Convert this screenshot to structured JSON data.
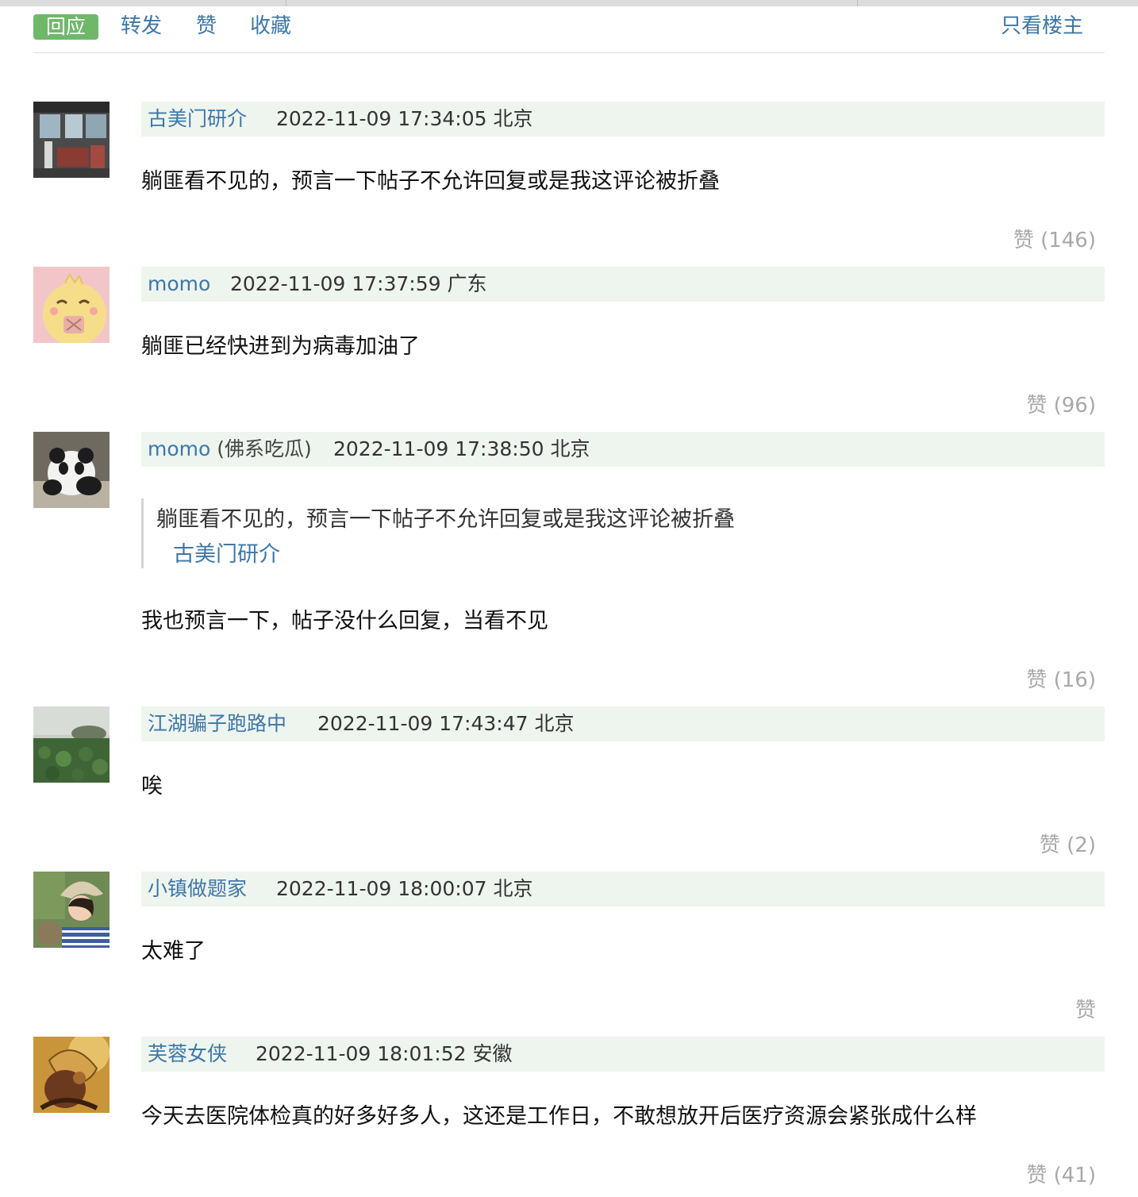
{
  "toolbar": {
    "reply": "回应",
    "forward": "转发",
    "like": "赞",
    "collect": "收藏",
    "op_only": "只看楼主"
  },
  "comments": [
    {
      "author": "古美门研介",
      "time": "2022-11-09 17:34:05 北京",
      "content": "躺匪看不见的，预言一下帖子不允许回复或是我这评论被折叠",
      "likes": "赞 (146)",
      "avatar_icon": "bus-interior-photo-icon"
    },
    {
      "author": "momo",
      "time": "2022-11-09 17:37:59 广东",
      "content": "躺匪已经快进到为病毒加油了",
      "likes": "赞 (96)",
      "avatar_icon": "cartoon-chick-icon"
    },
    {
      "author": "momo",
      "nick": "(佛系吃瓜)",
      "time": "2022-11-09 17:38:50 北京",
      "quote_text": "躺匪看不见的，预言一下帖子不允许回复或是我这评论被折叠",
      "quote_author": "古美门研介",
      "content": "我也预言一下，帖子没什么回复，当看不见",
      "likes": "赞 (16)",
      "avatar_icon": "panda-photo-icon"
    },
    {
      "author": "江湖骗子跑路中",
      "time": "2022-11-09 17:43:47 北京",
      "content": "唉",
      "likes": "赞 (2)",
      "avatar_icon": "lotus-pond-photo-icon"
    },
    {
      "author": "小镇做题家",
      "time": "2022-11-09 18:00:07 北京",
      "content": "太难了",
      "likes": "赞",
      "avatar_icon": "girl-sunhat-photo-icon"
    },
    {
      "author": "芙蓉女侠",
      "time": "2022-11-09 18:01:52 安徽",
      "content": "今天去医院体检真的好多好多人，这还是工作日，不敢想放开后医疗资源会紧张成什么样",
      "likes": "赞 (41)",
      "avatar_icon": "golden-painting-icon"
    }
  ]
}
